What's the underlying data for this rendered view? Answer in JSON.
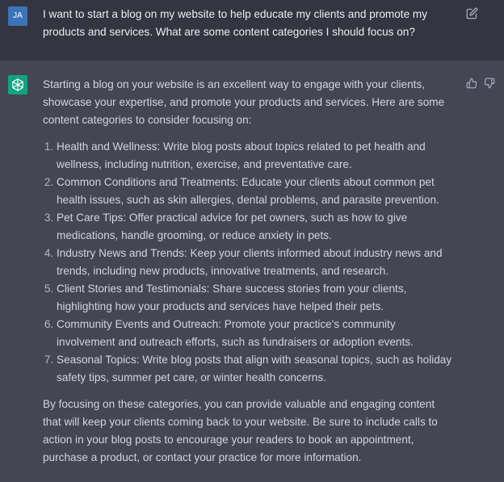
{
  "user_message": {
    "avatar_initials": "JA",
    "text": "I want to start a blog on my website to help educate my clients and promote my products and services. What are some content categories I should focus on?"
  },
  "assistant_message": {
    "intro": "Starting a blog on your website is an excellent way to engage with your clients, showcase your expertise, and promote your products and services. Here are some content categories to consider focusing on:",
    "items": [
      "Health and Wellness: Write blog posts about topics related to pet health and wellness, including nutrition, exercise, and preventative care.",
      "Common Conditions and Treatments: Educate your clients about common pet health issues, such as skin allergies, dental problems, and parasite prevention.",
      "Pet Care Tips: Offer practical advice for pet owners, such as how to give medications, handle grooming, or reduce anxiety in pets.",
      "Industry News and Trends: Keep your clients informed about industry news and trends, including new products, innovative treatments, and research.",
      "Client Stories and Testimonials: Share success stories from your clients, highlighting how your products and services have helped their pets.",
      "Community Events and Outreach: Promote your practice's community involvement and outreach efforts, such as fundraisers or adoption events.",
      "Seasonal Topics: Write blog posts that align with seasonal topics, such as holiday safety tips, summer pet care, or winter health concerns."
    ],
    "closing": "By focusing on these categories, you can provide valuable and engaging content that will keep your clients coming back to your website. Be sure to include calls to action in your blog posts to encourage your readers to book an appointment, purchase a product, or contact your practice for more information."
  },
  "icons": {
    "edit": "edit-icon",
    "thumbs_up": "thumbs-up-icon",
    "thumbs_down": "thumbs-down-icon",
    "assistant_logo": "openai-logo-icon"
  },
  "colors": {
    "user_bg": "#343541",
    "assistant_bg": "#444654",
    "user_avatar": "#3b74b8",
    "assistant_avatar": "#10a37f",
    "text": "#d1d5db"
  }
}
